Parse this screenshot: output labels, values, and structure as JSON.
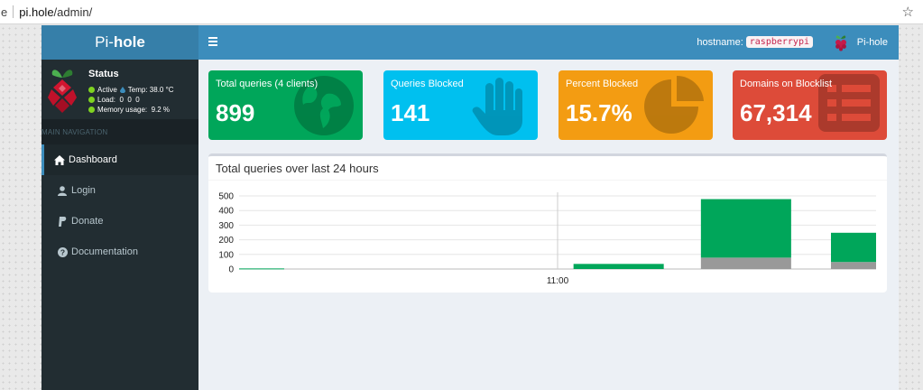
{
  "browser": {
    "url_prefix": "e",
    "url_host": "pi.hole",
    "url_path": "/admin/"
  },
  "logo": {
    "part1": "Pi-",
    "part2": "hole"
  },
  "topbar": {
    "hostname_label": "hostname:",
    "hostname_value": "raspberrypi",
    "user_label": "Pi-hole"
  },
  "sidebar": {
    "status_title": "Status",
    "status_active": "Active",
    "status_temp": "Temp: 38.0 °C",
    "status_load": "Load:  0  0  0",
    "status_memory": "Memory usage:  9.2 %",
    "nav_header": "MAIN NAVIGATION",
    "items": [
      {
        "label": "Dashboard",
        "icon": "home-icon"
      },
      {
        "label": "Login",
        "icon": "user-icon"
      },
      {
        "label": "Donate",
        "icon": "paypal-icon"
      },
      {
        "label": "Documentation",
        "icon": "question-circle-icon"
      }
    ]
  },
  "stats": [
    {
      "label": "Total queries (4 clients)",
      "value": "899",
      "icon": "globe-icon",
      "color": "#00a65a"
    },
    {
      "label": "Queries Blocked",
      "value": "141",
      "icon": "hand-icon",
      "color": "#00c0ef"
    },
    {
      "label": "Percent Blocked",
      "value": "15.7%",
      "icon": "pie-chart-icon",
      "color": "#f39c12"
    },
    {
      "label": "Domains on Blocklist",
      "value": "67,314",
      "icon": "list-icon",
      "color": "#dd4b39"
    }
  ],
  "chart": {
    "title": "Total queries over last 24 hours"
  },
  "chart_data": {
    "type": "bar",
    "title": "Total queries over last 24 hours",
    "xlabel": "",
    "ylabel": "",
    "ylim": [
      0,
      500
    ],
    "yticks": [
      0,
      100,
      200,
      300,
      400,
      500
    ],
    "xtick_labels": [
      "11:00"
    ],
    "x_range_hours": [
      0,
      24
    ],
    "xtick_hour": 12,
    "stacked": true,
    "grid": true,
    "colors": {
      "permitted": "#00a65a",
      "blocked": "#999999"
    },
    "bars": [
      {
        "start": 0,
        "end": 1.7,
        "permitted": 4,
        "blocked": 0
      },
      {
        "start": 12.6,
        "end": 16.0,
        "permitted": 35,
        "blocked": 0
      },
      {
        "start": 17.4,
        "end": 20.8,
        "permitted": 400,
        "blocked": 78
      },
      {
        "start": 22.3,
        "end": 24.0,
        "permitted": 200,
        "blocked": 48
      }
    ]
  }
}
